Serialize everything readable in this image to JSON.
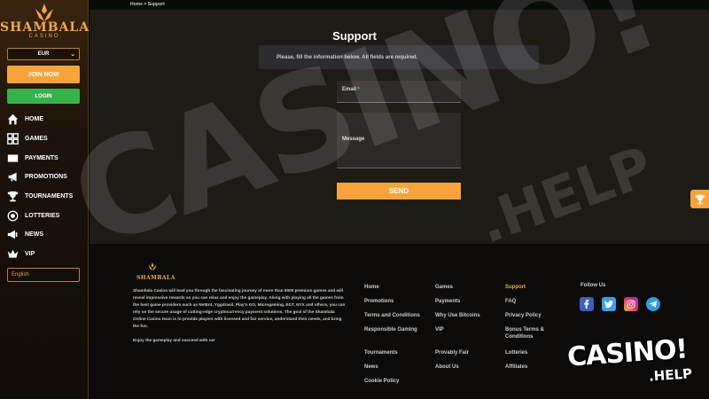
{
  "brand": {
    "name": "SHAMBALA",
    "sub": "CASINO",
    "accent": "#f7a33c",
    "login_color": "#37b24a"
  },
  "sidebar": {
    "currency": "EUR",
    "join_label": "JOIN NOW",
    "login_label": "LOGIN",
    "items": [
      {
        "label": "HOME",
        "icon": "home-icon"
      },
      {
        "label": "GAMES",
        "icon": "grid-icon"
      },
      {
        "label": "PAYMENTS",
        "icon": "payment-icon"
      },
      {
        "label": "PROMOTIONS",
        "icon": "megaphone-icon"
      },
      {
        "label": "TOURNAMENTS",
        "icon": "trophy-icon"
      },
      {
        "label": "LOTTERIES",
        "icon": "lottery-icon"
      },
      {
        "label": "NEWS",
        "icon": "news-icon"
      },
      {
        "label": "VIP",
        "icon": "crown-icon"
      }
    ],
    "language": "English"
  },
  "breadcrumb": {
    "home": "Home",
    "sep": ">",
    "current": "Support"
  },
  "support": {
    "title": "Support",
    "info": "Please, fill the information below. All fields are required.",
    "email_label": "Email",
    "required_mark": "*",
    "message_label": "Message",
    "send_label": "SEND"
  },
  "footer": {
    "logo_text": "SHAMBALA",
    "about": "Shambala Casino will lead you through the fascinating journey of more than 6000 premium games and will reveal impressive rewards so you can relax and enjoy the gameplay. Along with playing all the games from the best game providers such as NetEnt, Yggdrasil, Play'n GO, Microgaming, EGT, NYX and others, you can rely on the secure usage of cutting-edge cryptocurrency payment solutions. The goal of the Shambala Online Casino team is to provide players with licensed and fair service, understand their needs, and bring the fun.",
    "enjoy": "Enjoy the gameplay and succeed with us!",
    "col1": [
      "Home",
      "Promotions",
      "Terms and Conditions",
      "Responsible Gaming",
      "Tournaments",
      "News",
      "Cookie Policy"
    ],
    "col2": [
      "Games",
      "Payments",
      "Why Use Bitcoins",
      "VIP",
      "Provably Fair",
      "About Us"
    ],
    "col3": [
      "Support",
      "FAQ",
      "Privacy Policy",
      "Bonus Terms & Conditions",
      "Lotteries",
      "Affiliates"
    ],
    "follow": "Follow Us",
    "socials": [
      "facebook-icon",
      "twitter-icon",
      "instagram-icon",
      "telegram-icon"
    ]
  },
  "watermark": {
    "main": "CASINO!",
    "sub": ".HELP"
  }
}
